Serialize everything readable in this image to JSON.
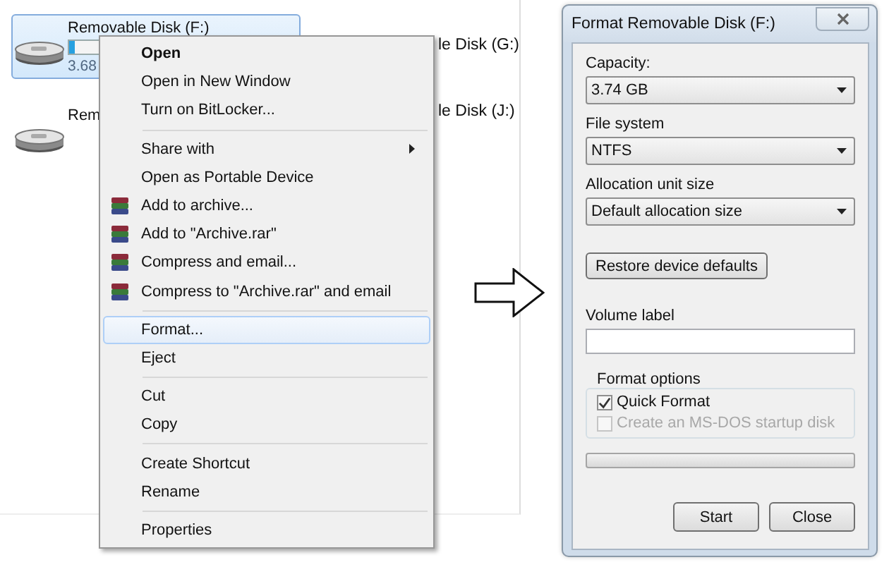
{
  "explorer": {
    "drives": [
      {
        "name": "Removable Disk (F:)",
        "detail": "3.68",
        "selected": true,
        "level": 0.03
      },
      {
        "name": "Rem",
        "selected": false
      }
    ],
    "column_2": [
      "le Disk (G:)",
      "le Disk (J:)"
    ]
  },
  "context_menu": {
    "groups": [
      [
        {
          "label": "Open",
          "default": true,
          "has_submenu": false,
          "selected": false
        },
        {
          "label": "Open in New Window",
          "default": false,
          "has_submenu": false,
          "selected": false
        },
        {
          "label": "Turn on BitLocker...",
          "default": false,
          "has_submenu": false,
          "selected": false
        }
      ],
      [
        {
          "label": "Share with",
          "default": false,
          "has_submenu": true,
          "selected": false
        },
        {
          "label": "Open as Portable Device",
          "default": false,
          "has_submenu": false,
          "selected": false
        },
        {
          "label": "Add to archive...",
          "kind": "archive",
          "default": false,
          "has_submenu": false,
          "selected": false
        },
        {
          "label": "Add to \"Archive.rar\"",
          "kind": "archive",
          "default": false,
          "has_submenu": false,
          "selected": false
        },
        {
          "label": "Compress and email...",
          "kind": "archive",
          "default": false,
          "has_submenu": false,
          "selected": false
        },
        {
          "label": "Compress to \"Archive.rar\" and email",
          "kind": "archive",
          "default": false,
          "has_submenu": false,
          "selected": false
        }
      ],
      [
        {
          "label": "Format...",
          "default": false,
          "has_submenu": false,
          "selected": true
        },
        {
          "label": "Eject",
          "default": false,
          "has_submenu": false,
          "selected": false
        }
      ],
      [
        {
          "label": "Cut",
          "default": false,
          "has_submenu": false,
          "selected": false
        },
        {
          "label": "Copy",
          "default": false,
          "has_submenu": false,
          "selected": false
        }
      ],
      [
        {
          "label": "Create Shortcut",
          "default": false,
          "has_submenu": false,
          "selected": false
        },
        {
          "label": "Rename",
          "default": false,
          "has_submenu": false,
          "selected": false
        }
      ],
      [
        {
          "label": "Properties",
          "default": false,
          "has_submenu": false,
          "selected": false
        }
      ]
    ]
  },
  "dialog": {
    "title": "Format Removable Disk (F:)",
    "dropdowns": [
      {
        "label": "Capacity:",
        "value": "3.74 GB"
      },
      {
        "label": "File system",
        "value": "NTFS"
      },
      {
        "label": "Allocation unit size",
        "value": "Default allocation size"
      }
    ],
    "restore_button": "Restore device defaults",
    "volume_label": {
      "label": "Volume label"
    },
    "format_options": {
      "title": "Format options",
      "checkboxes": [
        {
          "label": "Quick Format",
          "checked": true,
          "disabled": false
        },
        {
          "label": "Create an MS-DOS startup disk",
          "checked": false,
          "disabled": true
        }
      ]
    },
    "progress": {
      "level": 0
    },
    "buttons": [
      "Start",
      "Close"
    ]
  }
}
